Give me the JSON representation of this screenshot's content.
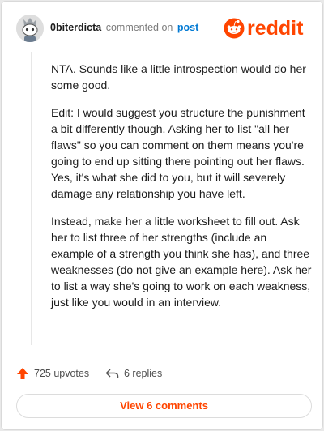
{
  "header": {
    "username": "0biterdicta",
    "action_text": "commented on",
    "post_link": "post",
    "logo_text": "reddit"
  },
  "comment": {
    "paragraphs": [
      "NTA. Sounds like a little introspection would do her some good.",
      "Edit: I would suggest you structure the punishment a bit differently though. Asking her to list \"all her flaws\" so you can comment on them means you're going to end up sitting there pointing out her flaws. Yes, it's what she did to you, but it will severely damage any relationship you have left.",
      "Instead, make her a little worksheet to fill out. Ask her to list three of her strengths (include an example of a strength you think she has), and three weaknesses (do not give an example here). Ask her to list a way she's going to work on each weakness, just like you would in an interview."
    ]
  },
  "actions": {
    "upvotes": "725 upvotes",
    "replies": "6 replies"
  },
  "footer": {
    "view_comments_label": "View 6 comments"
  },
  "colors": {
    "brand": "#ff4500",
    "link": "#0079d3"
  }
}
